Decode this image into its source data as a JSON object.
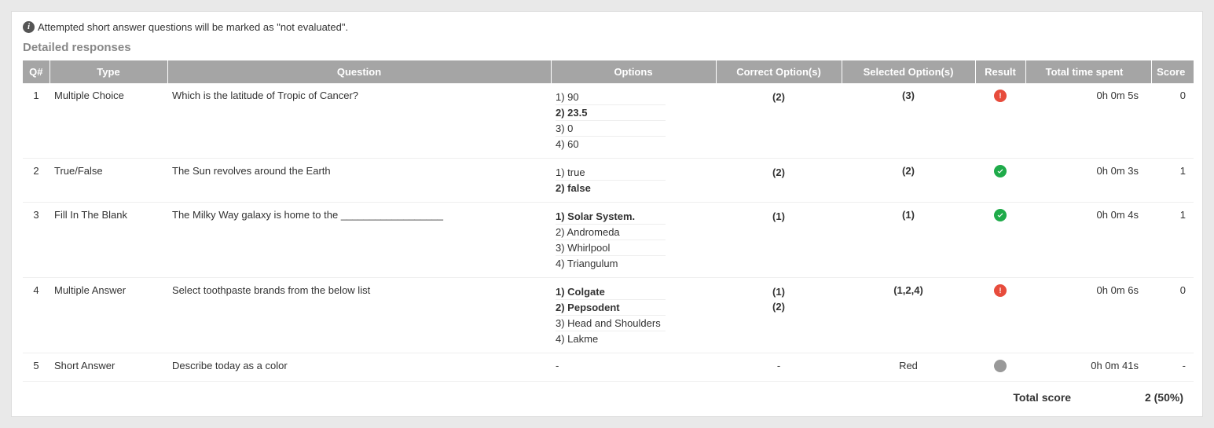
{
  "notice": "Attempted short answer questions will be marked as \"not evaluated\".",
  "section_title": "Detailed responses",
  "headers": {
    "qnum": "Q#",
    "type": "Type",
    "question": "Question",
    "options": "Options",
    "correct": "Correct Option(s)",
    "selected": "Selected Option(s)",
    "result": "Result",
    "time": "Total time spent",
    "score": "Score"
  },
  "rows": [
    {
      "qnum": "1",
      "type": "Multiple Choice",
      "question": "Which is the latitude of Tropic of Cancer?",
      "options": [
        {
          "text": "1) 90",
          "correct": false
        },
        {
          "text": "2) 23.5",
          "correct": true
        },
        {
          "text": "3) 0",
          "correct": false
        },
        {
          "text": "4) 60",
          "correct": false
        }
      ],
      "correct": [
        "(2)"
      ],
      "selected": "(3)",
      "selected_bold": true,
      "result": "bad",
      "time": "0h 0m 5s",
      "score": "0"
    },
    {
      "qnum": "2",
      "type": "True/False",
      "question": "The Sun revolves around the Earth",
      "options": [
        {
          "text": "1) true",
          "correct": false
        },
        {
          "text": "2) false",
          "correct": true
        }
      ],
      "correct": [
        "(2)"
      ],
      "selected": "(2)",
      "selected_bold": true,
      "result": "ok",
      "time": "0h 0m 3s",
      "score": "1"
    },
    {
      "qnum": "3",
      "type": "Fill In The Blank",
      "question": "The Milky Way galaxy is home to the __________________",
      "options": [
        {
          "text": "1) Solar System.",
          "correct": true
        },
        {
          "text": "2) Andromeda",
          "correct": false
        },
        {
          "text": "3) Whirlpool",
          "correct": false
        },
        {
          "text": "4) Triangulum",
          "correct": false
        }
      ],
      "correct": [
        "(1)"
      ],
      "selected": "(1)",
      "selected_bold": true,
      "result": "ok",
      "time": "0h 0m 4s",
      "score": "1"
    },
    {
      "qnum": "4",
      "type": "Multiple Answer",
      "question": "Select toothpaste brands from the below list",
      "options": [
        {
          "text": "1) Colgate",
          "correct": true
        },
        {
          "text": "2) Pepsodent",
          "correct": true
        },
        {
          "text": "3) Head and Shoulders",
          "correct": false
        },
        {
          "text": "4) Lakme",
          "correct": false
        }
      ],
      "correct": [
        "(1)",
        "(2)"
      ],
      "selected": "(1,2,4)",
      "selected_bold": true,
      "result": "bad",
      "time": "0h 0m 6s",
      "score": "0"
    },
    {
      "qnum": "5",
      "type": "Short Answer",
      "question": "Describe today as a color",
      "options_text": "-",
      "correct_text": "-",
      "selected": "Red",
      "selected_bold": false,
      "result": "neutral",
      "time": "0h 0m 41s",
      "score": "-"
    }
  ],
  "total": {
    "label": "Total score",
    "value": "2 (50%)"
  }
}
